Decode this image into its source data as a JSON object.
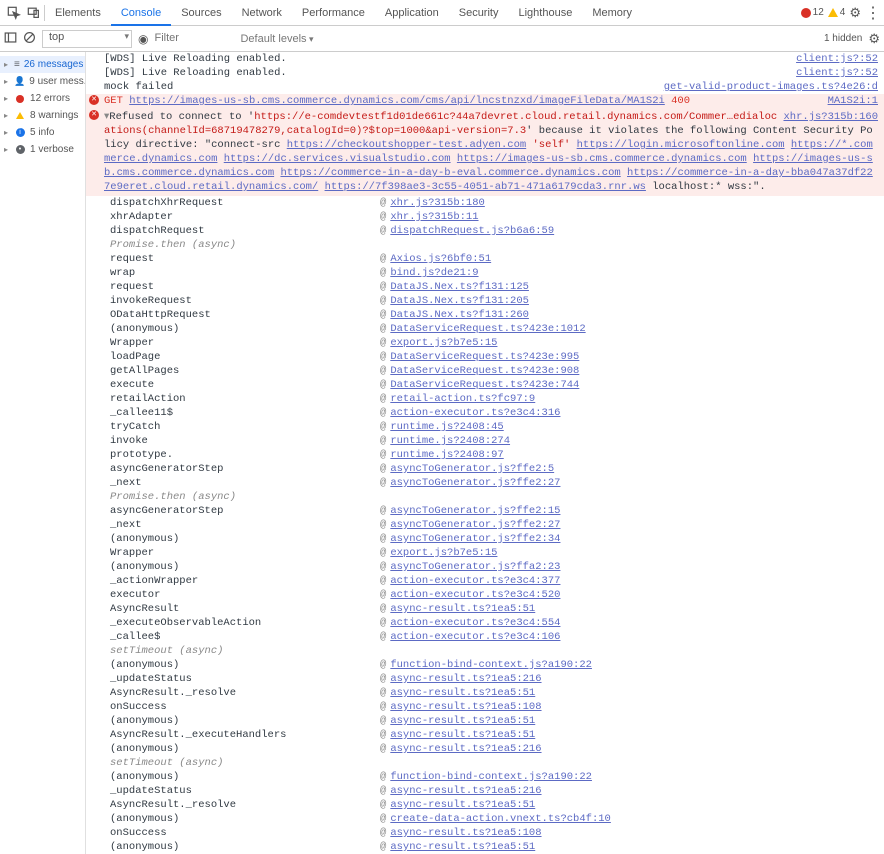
{
  "tabs": [
    "Elements",
    "Console",
    "Sources",
    "Network",
    "Performance",
    "Application",
    "Security",
    "Lighthouse",
    "Memory"
  ],
  "active_tab": 1,
  "top_status": {
    "errors": "12",
    "warnings": "4"
  },
  "toolbar": {
    "context": "top",
    "filter_placeholder": "Filter",
    "levels": "Default levels",
    "hidden": "1 hidden"
  },
  "sidebar": [
    {
      "icon": "messages",
      "label": "26 messages"
    },
    {
      "icon": "user",
      "label": "9 user mess..."
    },
    {
      "icon": "error",
      "label": "12 errors"
    },
    {
      "icon": "warning",
      "label": "8 warnings"
    },
    {
      "icon": "info",
      "label": "5 info"
    },
    {
      "icon": "verbose",
      "label": "1 verbose"
    }
  ],
  "log": [
    {
      "type": "plain",
      "msg": "[WDS] Live Reloading enabled.",
      "src": "client:js?:52"
    },
    {
      "type": "plain",
      "msg": "[WDS] Live Reloading enabled.",
      "src": "client:js?:52"
    },
    {
      "type": "plain",
      "msg": "mock failed",
      "src": "get-valid-product-images.ts?4e26:d"
    },
    {
      "type": "get_err",
      "method": "GET",
      "url": "https://images-us-sb.cms.commerce.dynamics.com/cms/api/lncstnzxd/imageFileData/MA1S2i",
      "code": "400",
      "src": "MA1S2i:1"
    },
    {
      "type": "csp",
      "prefix": "Refused to connect to '",
      "blocked_url": "https://e-comdevtestf1d01de661c?44a7devret.cloud.retail.dynamics.com/Commer…edialocations(channelId=68719478279,catalogId=0)?$top=1000&api-version=7.3",
      "mid1": "' because it violates the following Content Security Policy directive: \"connect-src ",
      "allowed": [
        "https://checkoutshopper-test.adyen.com",
        "'self'",
        "https://login.microsoftonline.com",
        "https://*.commerce.dynamics.com",
        "https://dc.services.visualstudio.com",
        "https://images-us-sb.cms.commerce.dynamics.com",
        "https://images-us-sb.cms.commerce.dynamics.com",
        "https://commerce-in-a-day-b-eval.commerce.dynamics.com",
        "https://commerce-in-a-day-bba047a37df227e9eret.cloud.retail.dynamics.com/",
        "https://7f398ae3-3c55-4051-ab71-471a6179cda3.rnr.ws"
      ],
      "tail": " localhost:* wss:\".",
      "src": "xhr.js?315b:160"
    }
  ],
  "trace": [
    {
      "fn": "dispatchXhrRequest",
      "loc": "xhr.js?315b:180"
    },
    {
      "fn": "xhrAdapter",
      "loc": "xhr.js?315b:11"
    },
    {
      "fn": "dispatchRequest",
      "loc": "dispatchRequest.js?b6a6:59"
    },
    {
      "fn": "Promise.then (async)",
      "async": true
    },
    {
      "fn": "request",
      "loc": "Axios.js?6bf0:51"
    },
    {
      "fn": "wrap",
      "loc": "bind.js?de21:9"
    },
    {
      "fn": "request",
      "loc": "DataJS.Nex.ts?f131:125"
    },
    {
      "fn": "invokeRequest",
      "loc": "DataJS.Nex.ts?f131:205"
    },
    {
      "fn": "ODataHttpRequest",
      "loc": "DataJS.Nex.ts?f131:260"
    },
    {
      "fn": "(anonymous)",
      "loc": "DataServiceRequest.ts?423e:1012"
    },
    {
      "fn": "Wrapper",
      "loc": "export.js?b7e5:15"
    },
    {
      "fn": "loadPage",
      "loc": "DataServiceRequest.ts?423e:995"
    },
    {
      "fn": "getAllPages",
      "loc": "DataServiceRequest.ts?423e:908"
    },
    {
      "fn": "execute",
      "loc": "DataServiceRequest.ts?423e:744"
    },
    {
      "fn": "retailAction",
      "loc": "retail-action.ts?fc97:9"
    },
    {
      "fn": "_callee11$",
      "loc": "action-executor.ts?e3c4:316"
    },
    {
      "fn": "tryCatch",
      "loc": "runtime.js?2408:45"
    },
    {
      "fn": "invoke",
      "loc": "runtime.js?2408:274"
    },
    {
      "fn": "prototype.<computed>",
      "loc": "runtime.js?2408:97"
    },
    {
      "fn": "asyncGeneratorStep",
      "loc": "asyncToGenerator.js?ffe2:5"
    },
    {
      "fn": "_next",
      "loc": "asyncToGenerator.js?ffe2:27"
    },
    {
      "fn": "Promise.then  (async)",
      "async": true
    },
    {
      "fn": "asyncGeneratorStep",
      "loc": "asyncToGenerator.js?ffe2:15"
    },
    {
      "fn": "_next",
      "loc": "asyncToGenerator.js?ffe2:27"
    },
    {
      "fn": "(anonymous)",
      "loc": "asyncToGenerator.js?ffe2:34"
    },
    {
      "fn": "Wrapper",
      "loc": "export.js?b7e5:15"
    },
    {
      "fn": "(anonymous)",
      "loc": "asyncToGenerator.js?ffa2:23"
    },
    {
      "fn": "_actionWrapper",
      "loc": "action-executor.ts?e3c4:377"
    },
    {
      "fn": "executor",
      "loc": "action-executor.ts?e3c4:520"
    },
    {
      "fn": "AsyncResult",
      "loc": "async-result.ts?1ea5:51"
    },
    {
      "fn": "_executeObservableAction",
      "loc": "action-executor.ts?e3c4:554"
    },
    {
      "fn": "_callee$",
      "loc": "action-executor.ts?e3c4:106"
    },
    {
      "fn": "setTimeout (async)",
      "async": true
    },
    {
      "fn": "(anonymous)",
      "loc": "function-bind-context.js?a190:22"
    },
    {
      "fn": "_updateStatus",
      "loc": "async-result.ts?1ea5:216"
    },
    {
      "fn": "AsyncResult._resolve",
      "loc": "async-result.ts?1ea5:51"
    },
    {
      "fn": "onSuccess",
      "loc": "async-result.ts?1ea5:108"
    },
    {
      "fn": "(anonymous)",
      "loc": "async-result.ts?1ea5:51"
    },
    {
      "fn": "AsyncResult._executeHandlers",
      "loc": "async-result.ts?1ea5:51"
    },
    {
      "fn": "(anonymous)",
      "loc": "async-result.ts?1ea5:216"
    },
    {
      "fn": "setTimeout (async)",
      "async": true
    },
    {
      "fn": "(anonymous)",
      "loc": "function-bind-context.js?a190:22"
    },
    {
      "fn": "_updateStatus",
      "loc": "async-result.ts?1ea5:216"
    },
    {
      "fn": "AsyncResult._resolve",
      "loc": "async-result.ts?1ea5:51"
    },
    {
      "fn": "(anonymous)",
      "loc": "create-data-action.vnext.ts?cb4f:10"
    },
    {
      "fn": "onSuccess",
      "loc": "async-result.ts?1ea5:108"
    },
    {
      "fn": "(anonymous)",
      "loc": "async-result.ts?1ea5:51"
    }
  ]
}
